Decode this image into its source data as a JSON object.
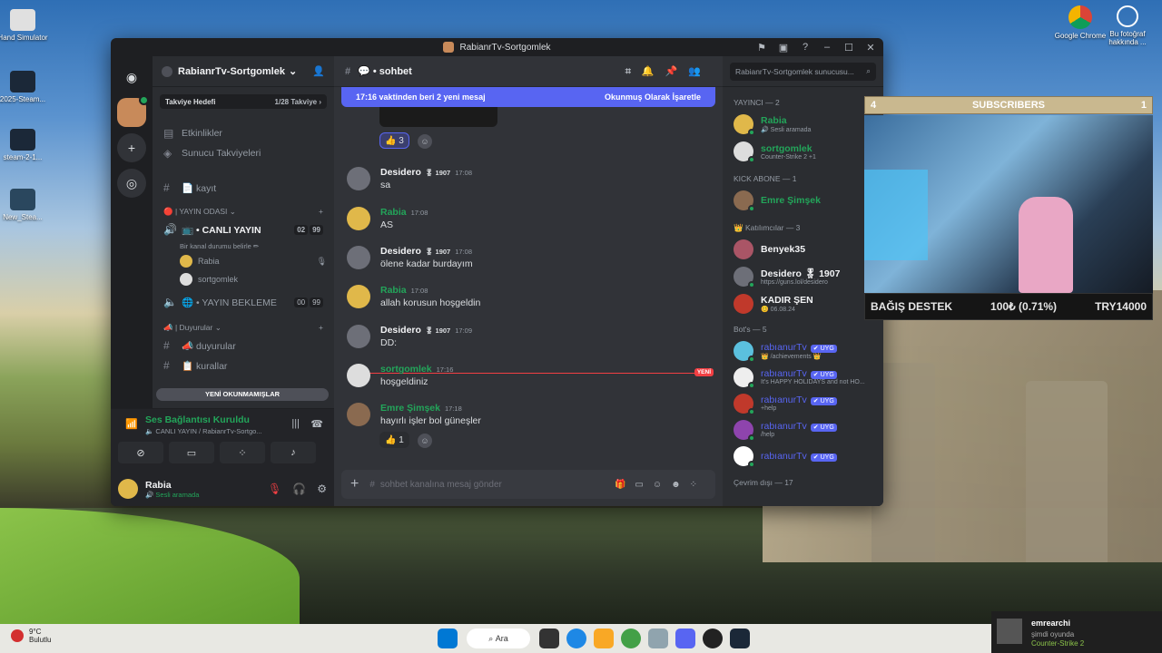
{
  "desktop": {
    "icons": [
      {
        "label": "Hand Simulator",
        "x": ""
      },
      {
        "label": "2025-Steam..."
      },
      {
        "label": "steam-2-1..."
      },
      {
        "label": "New_Stea..."
      },
      {
        "label": "Google Chrome"
      },
      {
        "label": "Bu fotoğraf hakkında ..."
      }
    ]
  },
  "window": {
    "title": "RabianrTv-Sortgomlek"
  },
  "server": {
    "name": "RabianrTv-Sortgomlek",
    "boost_label": "Takviye Hedefi",
    "boost_count": "1/28 Takviye ›",
    "events": "Etkinlikler",
    "boosts": "Sunucu Takviyeleri"
  },
  "channels": {
    "kayit": "📄 kayıt",
    "cat_yayin": "🔴 | YAYIN ODASI ⌄",
    "canli": "📺 • CANLI YAYIN",
    "canli_c1": "02",
    "canli_c2": "99",
    "canli_status": "Bir kanal durumu belirle ✏",
    "voice_user1": "Rabia",
    "voice_user2": "sortgomlek",
    "bekleme": "🌐 • YAYIN BEKLEME",
    "bekleme_c1": "00",
    "bekleme_c2": "99",
    "cat_duyuru": "📣 | Duyurular ⌄",
    "duyurular": "📣 duyurular",
    "kurallar": "📋 kurallar",
    "new_unread": "YENİ OKUNMAMIŞLAR"
  },
  "voice": {
    "status": "Ses Bağlantısı Kuruldu",
    "sub": "🔈 CANLI YAYIN / RabianrTv-Sortgo..."
  },
  "user": {
    "name": "Rabia",
    "status": "🔊 Sesli aramada"
  },
  "chat": {
    "channel": "💬 • sohbet",
    "banner_left": "17:16 vaktinden beri 2 yeni mesaj",
    "banner_right": "Okunmuş Olarak İşaretle",
    "top_reaction": "👍 3",
    "messages": [
      {
        "name": "Desidero",
        "tag": "🎖 1907",
        "time": "17:08",
        "text": "sa",
        "color": "#f2f3f5"
      },
      {
        "name": "Rabia",
        "tag": "",
        "time": "17:08",
        "text": "AS",
        "color": "#23a55a"
      },
      {
        "name": "Desidero",
        "tag": "🎖 1907",
        "time": "17:08",
        "text": "ölene kadar burdayım",
        "color": "#f2f3f5"
      },
      {
        "name": "Rabia",
        "tag": "",
        "time": "17:08",
        "text": "allah korusun hoşgeldin",
        "color": "#23a55a"
      },
      {
        "name": "Desidero",
        "tag": "🎖 1907",
        "time": "17:09",
        "text": "DD:",
        "color": "#f2f3f5"
      },
      {
        "name": "sortgomlek",
        "tag": "",
        "time": "17:16",
        "text": "hoşgeldiniz",
        "color": "#23a55a"
      },
      {
        "name": "Emre Şimşek",
        "tag": "",
        "time": "17:18",
        "text": "hayırlı işler bol güneşler",
        "color": "#23a55a"
      }
    ],
    "new_tag": "YENİ",
    "bottom_reaction": "👍 1",
    "composer_placeholder": "sohbet kanalına mesaj gönder"
  },
  "members": {
    "search_placeholder": "RabianrTv-Sortgomlek sunucusu...",
    "groups": [
      {
        "title": "YAYINCI — 2",
        "items": [
          {
            "name": "Rabia",
            "status": "🔊 Sesli aramada",
            "color": "#23a55a"
          },
          {
            "name": "sortgomlek",
            "status": "Counter-Strike 2 +1",
            "color": "#23a55a"
          }
        ]
      },
      {
        "title": "KICK ABONE — 1",
        "items": [
          {
            "name": "Emre Şimşek",
            "status": "",
            "color": "#23a55a"
          }
        ]
      },
      {
        "title": "👑 Katılımcılar — 3",
        "items": [
          {
            "name": "Benyek35",
            "status": "",
            "color": "#f2f3f5"
          },
          {
            "name": "Desidero 🎖 1907",
            "status": "https://guns.lol/desidero",
            "color": "#f2f3f5"
          },
          {
            "name": "KADIR ŞEN",
            "status": "😊 06.08.24",
            "color": "#f2f3f5"
          }
        ]
      },
      {
        "title": "Bot's — 5",
        "items": [
          {
            "name": "rabıanurTv",
            "status": "👑 /achievements 👑",
            "color": "#5865f2"
          },
          {
            "name": "rabıanurTv",
            "status": "It's HAPPY HOLIDAYS and not HO...",
            "color": "#5865f2"
          },
          {
            "name": "rabıanurTv",
            "status": "+help",
            "color": "#5865f2"
          },
          {
            "name": "rabıanurTv",
            "status": "/help",
            "color": "#5865f2"
          },
          {
            "name": "rabıanurTv",
            "status": "",
            "color": "#5865f2"
          }
        ]
      }
    ],
    "bot_badge": "✔ UYG",
    "offline": "Çevrim dışı — 17"
  },
  "overlay": {
    "subs_left": "4",
    "subs_title": "SUBSCRIBERS",
    "subs_right": "1",
    "donate_title": "BAĞIŞ DESTEK",
    "donate_amount": "100₺ (0.71%)",
    "donate_goal": "TRY14000"
  },
  "taskbar": {
    "weather_temp": "9°C",
    "weather_desc": "Bulutlu",
    "search": "Ara"
  },
  "notification": {
    "user": "emrearchi",
    "line1": "şimdi oyunda",
    "line2": "Counter-Strike 2"
  }
}
